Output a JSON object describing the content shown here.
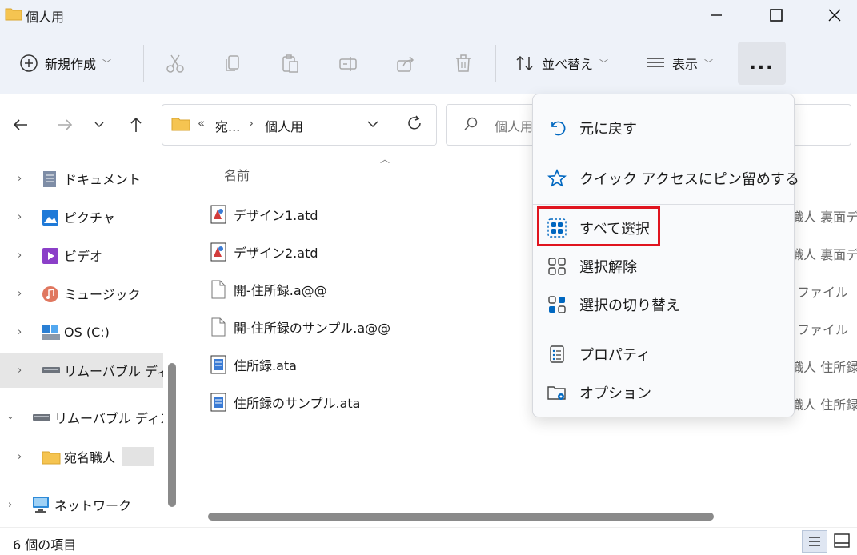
{
  "window": {
    "title": "個人用"
  },
  "toolbar": {
    "new_label": "新規作成",
    "sort_label": "並べ替え",
    "view_label": "表示",
    "more_label": "..."
  },
  "address": {
    "prefix": "«",
    "crumb1": "宛...",
    "crumb_sep": "›",
    "crumb2": "個人用",
    "search_placeholder": "個人用"
  },
  "sidebar": {
    "items": [
      {
        "label": "ドキュメント"
      },
      {
        "label": "ピクチャ"
      },
      {
        "label": "ビデオ"
      },
      {
        "label": "ミュージック"
      },
      {
        "label": "OS (C:)"
      },
      {
        "label": "リムーバブル ディス"
      },
      {
        "label": "リムーバブル ディスク"
      },
      {
        "label": "宛名職人"
      },
      {
        "label": "ネットワーク"
      }
    ]
  },
  "list": {
    "header_name": "名前",
    "files": [
      {
        "name": "デザイン1.atd",
        "extra": "職人 裏面デ"
      },
      {
        "name": "デザイン2.atd",
        "extra": "職人 裏面デ"
      },
      {
        "name": "開-住所録.a@@",
        "extra": "ファイル"
      },
      {
        "name": "開-住所録のサンプル.a@@",
        "extra": "ファイル"
      },
      {
        "name": "住所録.ata",
        "extra": "職人 住所録"
      },
      {
        "name": "住所録のサンプル.ata",
        "extra": "職人 住所録"
      }
    ]
  },
  "status": {
    "count": "6 個の項目"
  },
  "menu": {
    "items": [
      {
        "label": "元に戻す",
        "icon": "undo-icon"
      },
      {
        "label": "クイック アクセスにピン留めする",
        "icon": "star-icon"
      },
      {
        "label": "すべて選択",
        "icon": "select-all-icon"
      },
      {
        "label": "選択解除",
        "icon": "select-none-icon"
      },
      {
        "label": "選択の切り替え",
        "icon": "invert-selection-icon"
      },
      {
        "label": "プロパティ",
        "icon": "properties-icon"
      },
      {
        "label": "オプション",
        "icon": "options-icon"
      }
    ]
  },
  "colors": {
    "accent": "#0067c0",
    "highlight": "#e0141f",
    "folder": "#f5c451"
  }
}
